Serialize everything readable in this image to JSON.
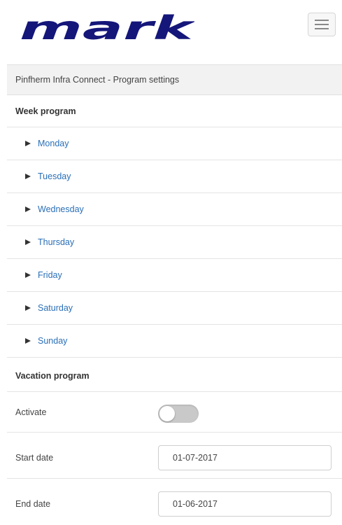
{
  "header": {
    "logo_text": "mark",
    "menu_icon": "hamburger-menu-icon"
  },
  "title_bar": {
    "text": "Pinfherm Infra Connect - Program settings"
  },
  "week_program": {
    "title": "Week program",
    "days": [
      {
        "label": "Monday"
      },
      {
        "label": "Tuesday"
      },
      {
        "label": "Wednesday"
      },
      {
        "label": "Thursday"
      },
      {
        "label": "Friday"
      },
      {
        "label": "Saturday"
      },
      {
        "label": "Sunday"
      }
    ]
  },
  "vacation_program": {
    "title": "Vacation program",
    "activate_label": "Activate",
    "activate_on": false,
    "start_label": "Start date",
    "start_value": "01-07-2017",
    "end_label": "End date",
    "end_value": "01-06-2017"
  },
  "colors": {
    "brand": "#14167a",
    "link": "#2a6fb8",
    "toggle_off": "#c9c9c9"
  }
}
